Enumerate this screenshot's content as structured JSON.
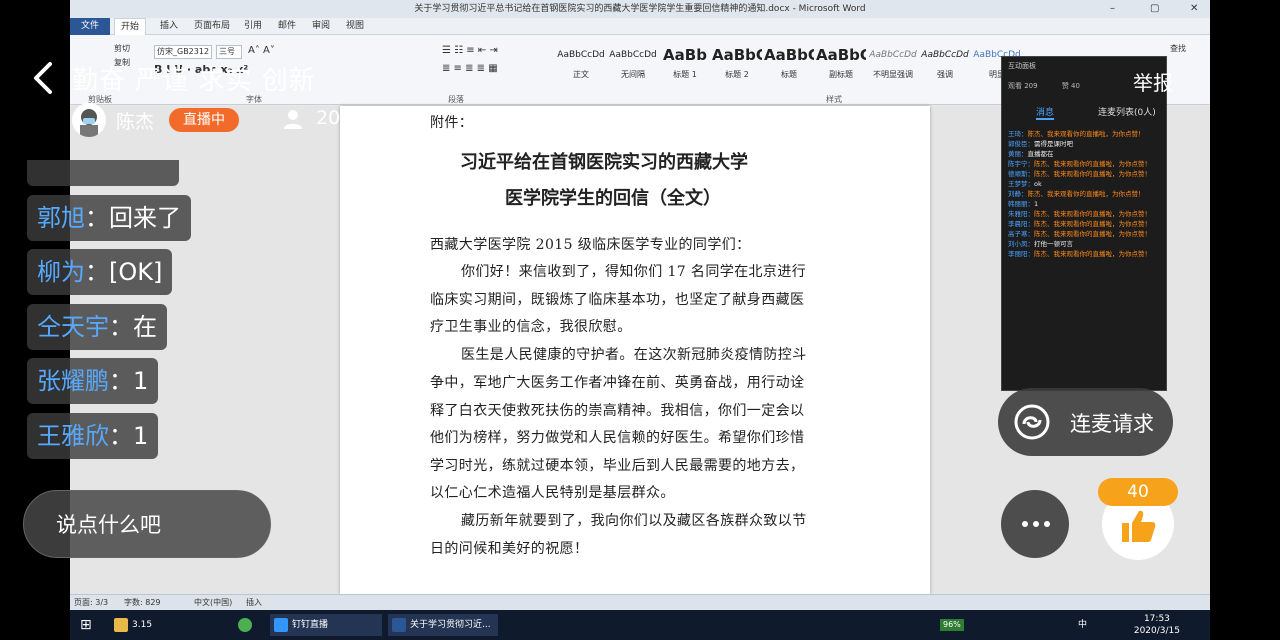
{
  "word": {
    "window_title": "关于学习贯彻习近平总书记给在首钢医院实习的西藏大学医学院学生重要回信精神的通知.docx - Microsoft Word",
    "tabs": [
      "文件",
      "开始",
      "插入",
      "页面布局",
      "引用",
      "邮件",
      "审阅",
      "视图"
    ],
    "ribbon": {
      "font_name": "仿宋_GB2312",
      "font_size": "三号",
      "clipboard_label": "剪贴板",
      "font_label": "字体",
      "paragraph_label": "段落",
      "styles_label": "样式",
      "cut": "剪切",
      "copy": "复制",
      "find": "查找",
      "styles": [
        {
          "preview": "AaBbCcDd",
          "name": "正文"
        },
        {
          "preview": "AaBbCcDd",
          "name": "无间隔"
        },
        {
          "preview": "AaBb",
          "name": "标题 1"
        },
        {
          "preview": "AaBbC",
          "name": "标题 2"
        },
        {
          "preview": "AaBbC",
          "name": "标题"
        },
        {
          "preview": "AaBbC",
          "name": "副标题"
        },
        {
          "preview": "AaBbCcDd",
          "name": "不明显强调"
        },
        {
          "preview": "AaBbCcDd",
          "name": "强调"
        },
        {
          "preview": "AaBbCcDd",
          "name": "明显"
        }
      ]
    },
    "document": {
      "attachment_label": "附件：",
      "title_line1": "习近平给在首钢医院实习的西藏大学",
      "title_line2": "医学院学生的回信（全文）",
      "lines": [
        "西藏大学医学院 2015 级临床医学专业的同学们：",
        "你们好！来信收到了，得知你们 17 名同学在北京进行",
        "临床实习期间，既锻炼了临床基本功，也坚定了献身西藏医",
        "疗卫生事业的信念，我很欣慰。",
        "医生是人民健康的守护者。在这次新冠肺炎疫情防控斗",
        "争中，军地广大医务工作者冲锋在前、英勇奋战，用行动诠",
        "释了白衣天使救死扶伤的崇高精神。我相信，你们一定会以",
        "他们为榜样，努力做党和人民信赖的好医生。希望你们珍惜",
        "学习时光，练就过硬本领，毕业后到人民最需要的地方去，",
        "以仁心仁术造福人民特别是基层群众。",
        "藏历新年就要到了，我向你们以及藏区各族群众致以节",
        "日的问候和美好的祝愿！"
      ]
    },
    "status": {
      "page": "页面: 3/3",
      "words": "字数: 829",
      "language": "中文(中国)",
      "mode": "插入"
    },
    "taskbar": {
      "items": [
        "3.15",
        "钉钉直播",
        "关于学习贯彻习近..."
      ],
      "battery": "96%",
      "time": "17:53",
      "date": "2020/3/15",
      "ime": "中"
    }
  },
  "chat_panel": {
    "title": "互动面板",
    "views": "观看 209",
    "likes": "赞 40",
    "tab_messages": "消息",
    "tab_mic": "连麦列表(0人)",
    "messages": [
      {
        "name": "王琦",
        "text": "陈杰、我来观看你的直播啦，为你点赞！"
      },
      {
        "name": "郭俊臣",
        "text": "需得是课时吧"
      },
      {
        "name": "黄丽",
        "text": "直播都在"
      },
      {
        "name": "陈宇宁",
        "text": "陈杰、我来观看你的直播啦，为你点赞！"
      },
      {
        "name": "德顺斯",
        "text": "陈杰、我来观看你的直播啦，为你点赞！"
      },
      {
        "name": "王梦梦",
        "text": "ok"
      },
      {
        "name": "刘静",
        "text": "陈杰、我来观看你的直播啦，为你点赞！"
      },
      {
        "name": "韩丽丽",
        "text": "1"
      },
      {
        "name": "朱雅阳",
        "text": "陈杰、我来观看你的直播啦，为你点赞！"
      },
      {
        "name": "李晨阳",
        "text": "陈杰、我来观看你的直播啦，为你点赞！"
      },
      {
        "name": "高子寒",
        "text": "陈杰、我来观看你的直播啦，为你点赞！"
      },
      {
        "name": "刘小凤",
        "text": "打他一顿可言"
      },
      {
        "name": "李丽阳",
        "text": "陈杰、我来观看你的直播啦，为你点赞！"
      }
    ]
  },
  "overlay": {
    "motto": "勤奋 严谨 求实 创新",
    "host_name": "陈杰",
    "live_badge": "直播中",
    "viewer_count": "209",
    "report": "举报",
    "comments": [
      {
        "name": "郭旭",
        "text": "：回来了"
      },
      {
        "name": "柳为",
        "text": "：[OK]"
      },
      {
        "name": "仝天宇",
        "text": "：在"
      },
      {
        "name": "张耀鹏",
        "text": "：1"
      },
      {
        "name": "王雅欣",
        "text": "：1"
      }
    ],
    "say_placeholder": "说点什么吧",
    "mic_request": "连麦请求",
    "like_count": "40",
    "colors": {
      "live_badge": "#f26b2b",
      "like_badge": "#f7a21b",
      "commenter_name": "#57a8ff"
    }
  }
}
